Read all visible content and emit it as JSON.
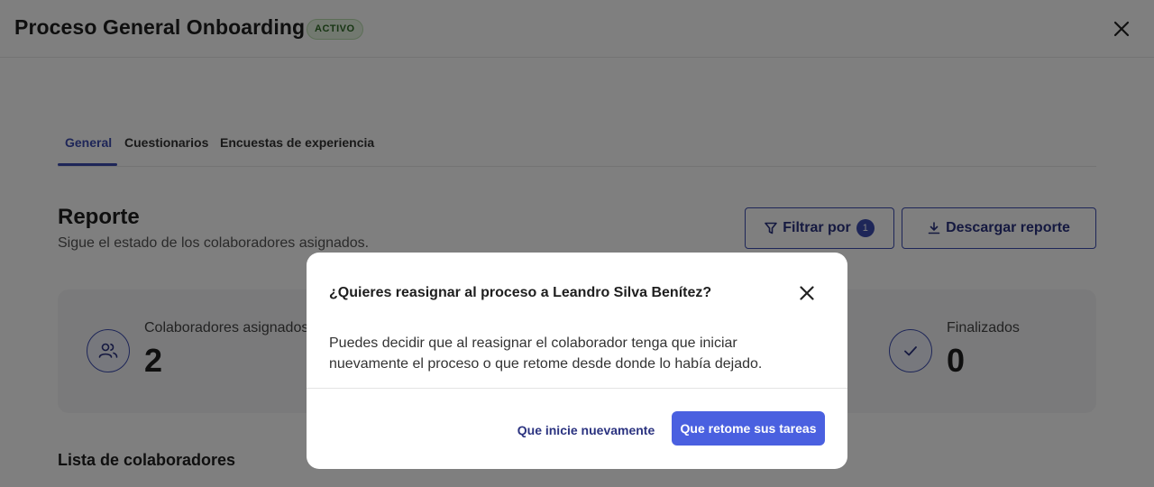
{
  "header": {
    "title": "Proceso General Onboarding",
    "status_badge": "ACTIVO"
  },
  "tabs": [
    {
      "label": "General",
      "active": true
    },
    {
      "label": "Cuestionarios",
      "active": false
    },
    {
      "label": "Encuestas de experiencia",
      "active": false
    }
  ],
  "report": {
    "title": "Reporte",
    "subtitle": "Sigue el estado de los colaboradores asignados.",
    "filter_label": "Filtrar por",
    "filter_count": "1",
    "download_label": "Descargar reporte"
  },
  "stats": [
    {
      "label": "Colaboradores asignados",
      "value": "2",
      "icon": "users-icon"
    },
    {
      "label": "Finalizados",
      "value": "0",
      "icon": "check-icon"
    }
  ],
  "list": {
    "title": "Lista de colaboradores"
  },
  "modal": {
    "title": "¿Quieres reasignar al proceso a Leandro Silva Benítez?",
    "body": "Puedes decidir que al reasignar el colaborador tenga que iniciar nuevamente el proceso o que retome desde donde lo había dejado.",
    "secondary_label": "Que inicie nuevamente",
    "primary_label": "Que retome sus tareas"
  },
  "colors": {
    "accent": "#3d4db0",
    "primary_button": "#4a60e0",
    "badge_bg": "#e5f3e0",
    "badge_text": "#2e6a26"
  }
}
